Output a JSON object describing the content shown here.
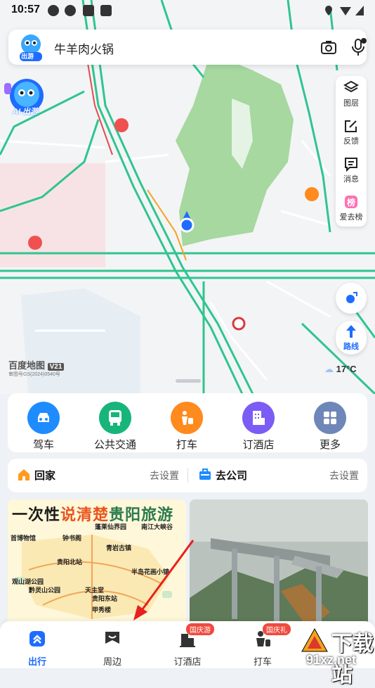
{
  "status_bar": {
    "time": "10:57"
  },
  "search": {
    "mascot_label": "出游",
    "query": "牛羊肉火锅"
  },
  "ai_bubble": {
    "label": "AI 出游"
  },
  "tools": [
    {
      "label": "图层",
      "icon": "layers-icon"
    },
    {
      "label": "反馈",
      "icon": "edit-icon"
    },
    {
      "label": "消息",
      "icon": "message-icon"
    },
    {
      "label": "爱去榜",
      "icon": "ranking-icon"
    }
  ],
  "route_button": {
    "label": "路线"
  },
  "map_info": {
    "brand": "百度地图",
    "version": "V21",
    "approval": "审图号GS(2024)0540号",
    "temperature": "17°C"
  },
  "quick_actions": [
    {
      "label": "驾车",
      "color": "#1e8cff",
      "icon": "car-icon"
    },
    {
      "label": "公共交通",
      "color": "#17b57a",
      "icon": "bus-icon"
    },
    {
      "label": "打车",
      "color": "#ff8a1d",
      "icon": "taxi-icon"
    },
    {
      "label": "订酒店",
      "color": "#7b5cf5",
      "icon": "hotel-icon"
    },
    {
      "label": "更多",
      "color": "#6f86b8",
      "icon": "more-icon"
    }
  ],
  "home_company": {
    "home": {
      "label": "回家",
      "action": "去设置"
    },
    "company": {
      "label": "去公司",
      "action": "去设置"
    }
  },
  "feed": {
    "card1": {
      "headline_pre": "一次性",
      "headline_hl": "说清楚",
      "headline_post": "贵阳旅游",
      "places": [
        "蓬莱仙界园",
        "南江大峡谷",
        "首博物馆",
        "钟书阁",
        "青岩古镇",
        "贵阳北站",
        "观山湖公园",
        "黔灵山公园",
        "天主堂",
        "贵阳东站",
        "半岛花画小镇",
        "甲秀楼"
      ]
    }
  },
  "bottom_nav": [
    {
      "label": "出行",
      "active": true,
      "icon": "travel-icon"
    },
    {
      "label": "周边",
      "active": false,
      "icon": "nearby-icon"
    },
    {
      "label": "订酒店",
      "active": false,
      "badge": "国庆游",
      "icon": "hotel-nav-icon"
    },
    {
      "label": "打车",
      "active": false,
      "badge": "国庆礼",
      "icon": "taxi-nav-icon"
    }
  ],
  "watermark_site": {
    "title": "下载站",
    "domain": "91xz.net"
  },
  "colors": {
    "accent": "#1e6cff",
    "road": "#2fc58f",
    "park": "#9bd49a",
    "badge": "#f04a3e"
  }
}
